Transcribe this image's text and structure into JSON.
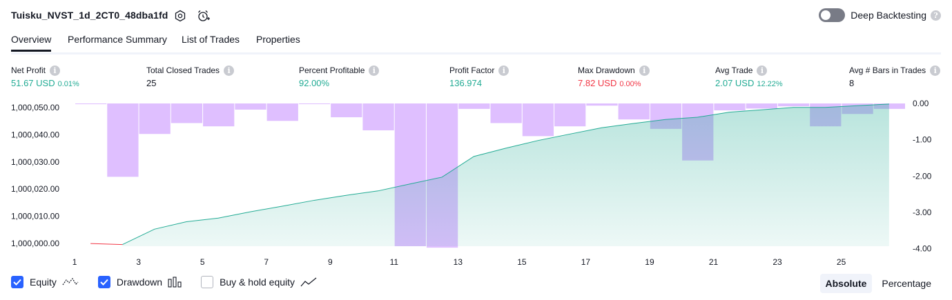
{
  "header": {
    "strategy_title": "Tuisku_NVST_1d_2CT0_48dba1fd",
    "settings_icon": "gear-icon",
    "alert_icon": "alarm-clock-plus-icon",
    "deep_backtesting_label": "Deep Backtesting",
    "deep_backtesting_enabled": false
  },
  "tabs": [
    {
      "label": "Overview",
      "active": true
    },
    {
      "label": "Performance Summary",
      "active": false
    },
    {
      "label": "List of Trades",
      "active": false
    },
    {
      "label": "Properties",
      "active": false
    }
  ],
  "stats": {
    "net_profit": {
      "label": "Net Profit",
      "value": "51.67 USD",
      "pct": "0.01%"
    },
    "total_closed_trades": {
      "label": "Total Closed Trades",
      "value": "25"
    },
    "percent_profitable": {
      "label": "Percent Profitable",
      "value": "92.00%"
    },
    "profit_factor": {
      "label": "Profit Factor",
      "value": "136.974"
    },
    "max_drawdown": {
      "label": "Max Drawdown",
      "value": "7.82 USD",
      "pct": "0.00%"
    },
    "avg_trade": {
      "label": "Avg Trade",
      "value": "2.07 USD",
      "pct": "12.22%"
    },
    "avg_bars": {
      "label": "Avg # Bars in Trades",
      "value": "8"
    }
  },
  "chart_data": {
    "type": "area",
    "x": [
      1,
      2,
      3,
      4,
      5,
      6,
      7,
      8,
      9,
      10,
      11,
      12,
      13,
      14,
      15,
      16,
      17,
      18,
      19,
      20,
      21,
      22,
      23,
      24,
      25,
      26
    ],
    "x_tick_labels": [
      "1",
      "3",
      "5",
      "7",
      "9",
      "11",
      "13",
      "15",
      "17",
      "19",
      "21",
      "23",
      "25"
    ],
    "y_left_tick_labels": [
      "1,000,050.00",
      "1,000,040.00",
      "1,000,030.00",
      "1,000,020.00",
      "1,000,010.00",
      "1,000,000.00"
    ],
    "y_left_ticks": [
      1000050,
      1000040,
      1000030,
      1000020,
      1000010,
      1000000
    ],
    "y_left_range": [
      999999,
      1000051.5
    ],
    "y_right_tick_labels": [
      "0.00",
      "-1.00",
      "-2.00",
      "-3.00",
      "-4.00"
    ],
    "y_right_ticks": [
      0,
      -1,
      -2,
      -3,
      -4
    ],
    "y_right_range": [
      -3.93,
      0
    ],
    "series": [
      {
        "name": "Equity",
        "color": "#22ab94",
        "loss_color": "#f23645",
        "values": [
          999999.98,
          999999.61,
          1000005.26,
          1000008.01,
          1000009.34,
          1000011.65,
          1000013.72,
          1000015.88,
          1000017.71,
          1000019.34,
          1000021.9,
          1000024.38,
          1000032.0,
          1000035.05,
          1000037.85,
          1000040.23,
          1000042.56,
          1000044.14,
          1000045.6,
          1000046.43,
          1000048.29,
          1000049.16,
          1000050.04,
          1000050.04,
          1000050.69,
          1000051.29
        ]
      },
      {
        "name": "Drawdown",
        "color": "#d1a4ff",
        "values": [
          -0.02,
          -2.02,
          -0.84,
          -0.54,
          -0.63,
          -0.17,
          -0.48,
          -0.01,
          -0.38,
          -0.74,
          -3.93,
          -3.97,
          -0.15,
          -0.54,
          -0.9,
          -0.63,
          -0.06,
          -0.44,
          -0.7,
          -1.57,
          -0.19,
          -0.14,
          -0.08,
          -0.63,
          -0.29,
          -0.15
        ]
      }
    ],
    "xlabel": "",
    "ylabel": ""
  },
  "legend": {
    "equity": {
      "label": "Equity",
      "checked": true
    },
    "drawdown": {
      "label": "Drawdown",
      "checked": true
    },
    "buy_hold": {
      "label": "Buy & hold equity",
      "checked": false
    }
  },
  "view_toggle": {
    "absolute_label": "Absolute",
    "percentage_label": "Percentage",
    "active": "Absolute"
  }
}
